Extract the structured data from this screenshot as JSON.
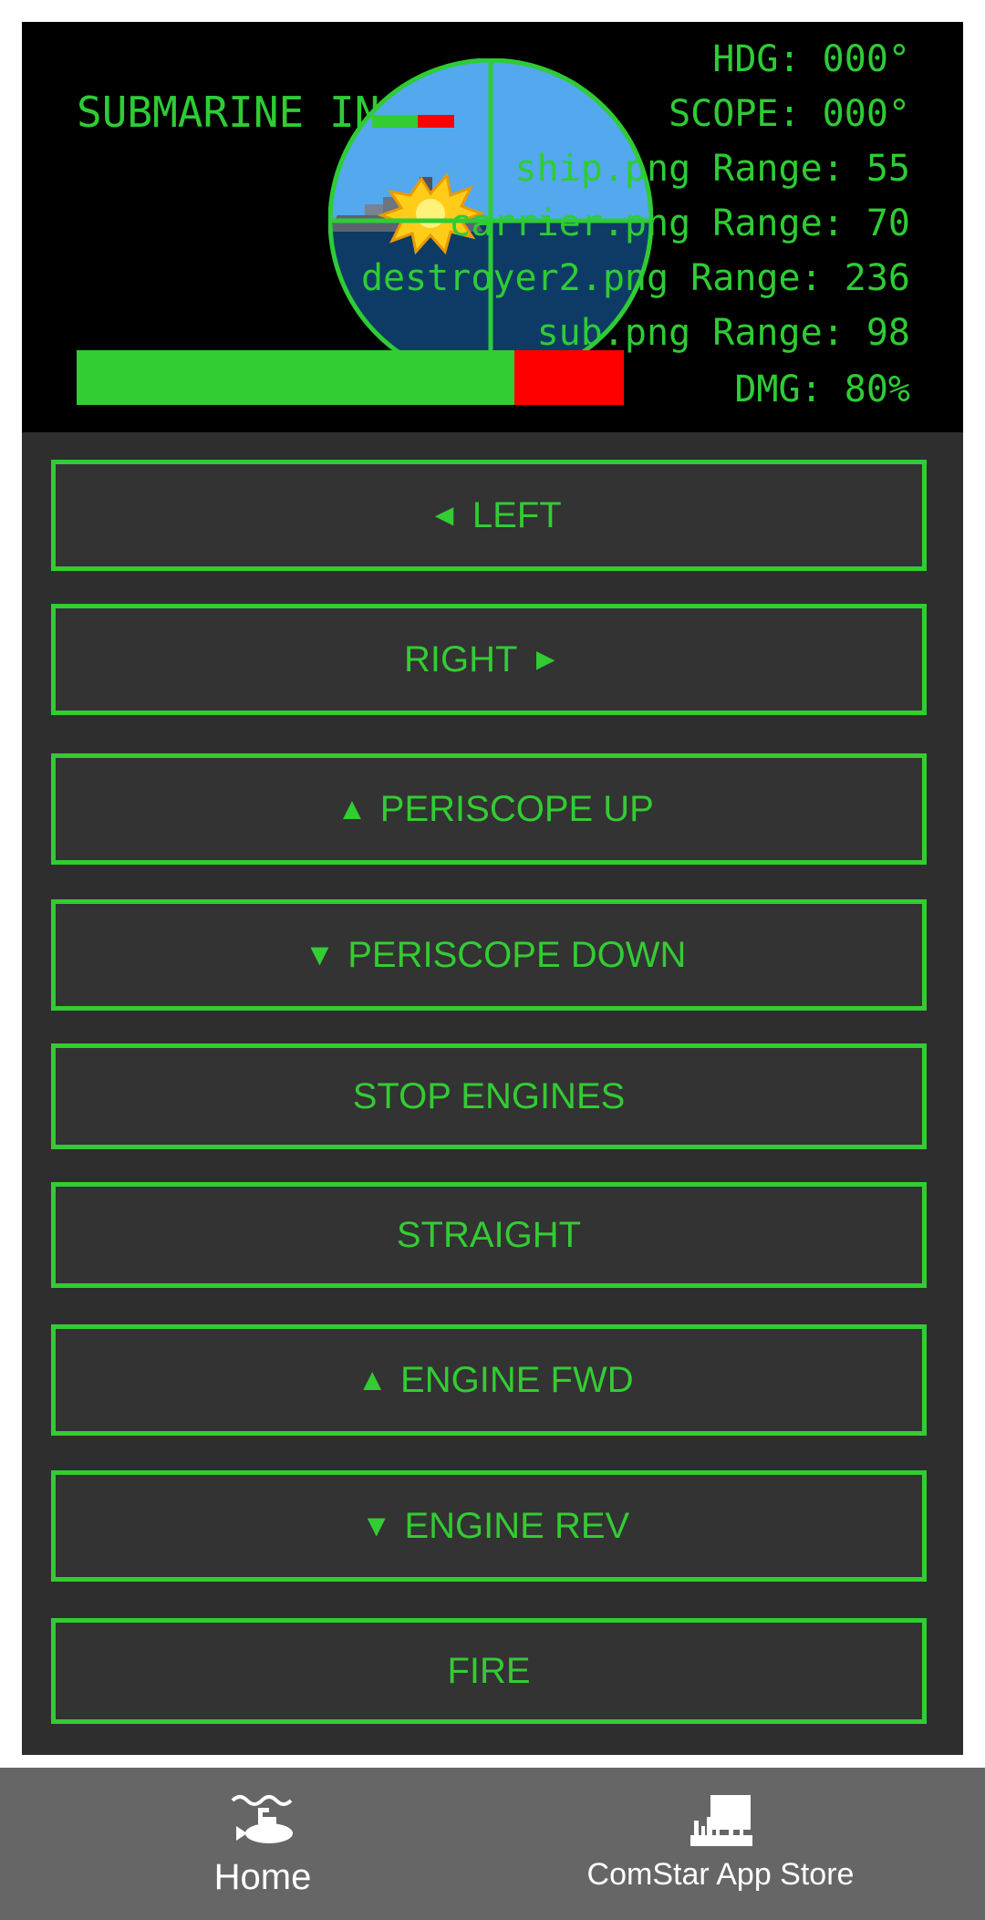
{
  "hud": {
    "title": "SUBMARINE IN",
    "heading": "HDG: 000°",
    "scope": "SCOPE: 000°",
    "contacts": [
      "ship.png Range: 55",
      "carrier.png Range: 70",
      "destroyer2.png Range: 236",
      "sub.png Range: 98"
    ],
    "damage": "DMG: 80%",
    "hull_integrity_fraction": 0.8
  },
  "controls": [
    {
      "name": "left-button",
      "glyph_before": "◄",
      "label": "LEFT",
      "glyph_after": ""
    },
    {
      "name": "right-button",
      "glyph_before": "",
      "label": "RIGHT",
      "glyph_after": "►"
    },
    {
      "name": "periscope-up-button",
      "glyph_before": "▲",
      "label": "PERISCOPE UP",
      "glyph_after": ""
    },
    {
      "name": "periscope-down-button",
      "glyph_before": "▼",
      "label": "PERISCOPE DOWN",
      "glyph_after": ""
    },
    {
      "name": "stop-engines-button",
      "glyph_before": "",
      "label": "STOP ENGINES",
      "glyph_after": ""
    },
    {
      "name": "straight-button",
      "glyph_before": "",
      "label": "STRAIGHT",
      "glyph_after": ""
    },
    {
      "name": "engine-fwd-button",
      "glyph_before": "▲",
      "label": "ENGINE FWD",
      "glyph_after": ""
    },
    {
      "name": "engine-rev-button",
      "glyph_before": "▼",
      "label": "ENGINE REV",
      "glyph_after": ""
    },
    {
      "name": "fire-button",
      "glyph_before": "",
      "label": "FIRE",
      "glyph_after": ""
    }
  ],
  "tabbar": {
    "home_label": "Home",
    "home_icon": "submarine-icon",
    "store_label": "ComStar App Store",
    "store_icon": "store-skyline-icon"
  },
  "colors": {
    "accent_green": "#33cc33",
    "damage_red": "#ff0000",
    "panel_bg": "#333333",
    "hud_bg": "#000000"
  }
}
